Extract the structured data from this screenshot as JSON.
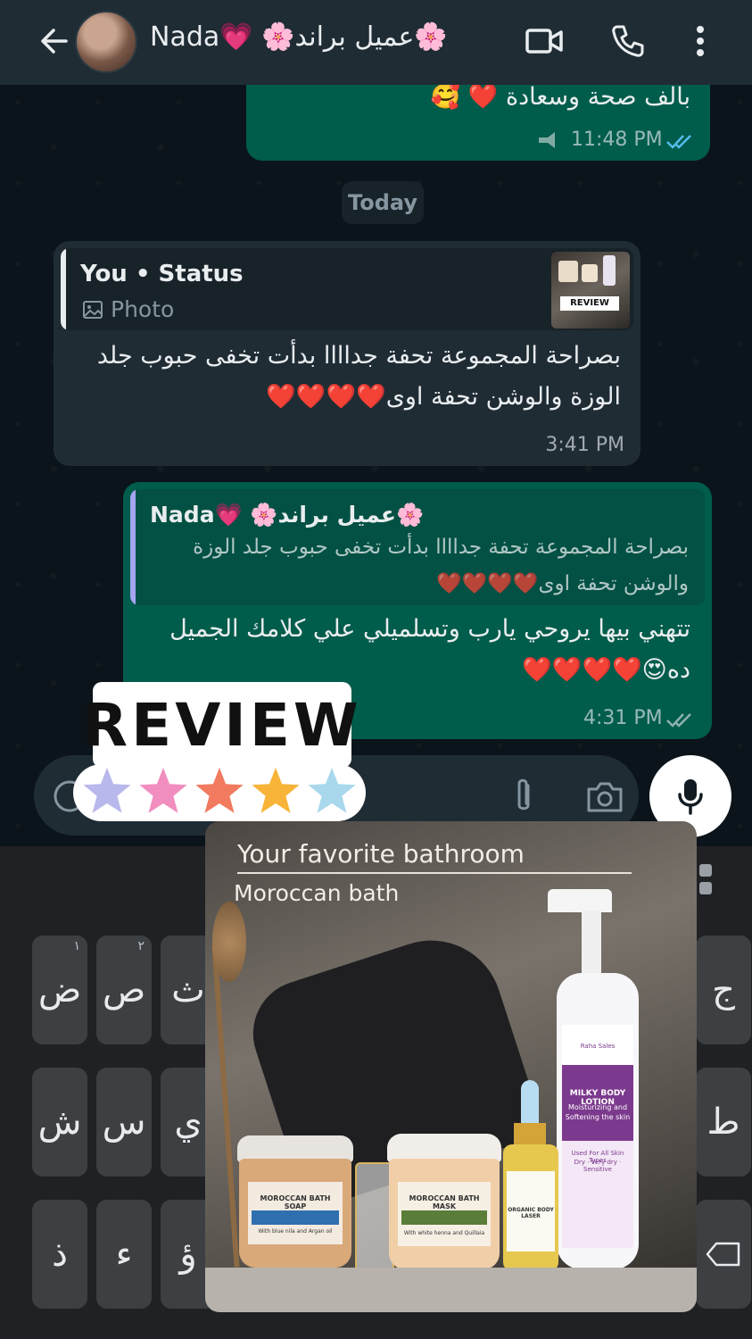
{
  "header": {
    "contact_name": "Nada💗 🌸عميل براند🌸"
  },
  "messages": {
    "prev_partial_text": "بالف صحة وسعادة ❤️ 🥰",
    "prev_time": "11:48 PM",
    "date_separator": "Today",
    "status_reply": {
      "sender": "You • Status",
      "media_label": "Photo",
      "text_line1": "بصراحة المجموعة تحفة جداااا بدأت تخفى حبوب جلد",
      "text_line2": "الوزة والوشن تحفة اوى❤️❤️❤️❤️",
      "time": "3:41 PM"
    },
    "reply": {
      "quoted_name": "Nada💗 🌸عميل براند🌸",
      "quoted_line1": "بصراحة المجموعة تحفة جداااا بدأت تخفى حبوب جلد الوزة",
      "quoted_line2": "والوشن تحفة اوى❤️❤️❤️❤️",
      "text_line1": "تتهني بيها يروحي يارب وتسلميلي علي كلامك الجميل",
      "text_line2": "ده😍❤️❤️❤️❤️",
      "time": "4:31 PM"
    }
  },
  "sticker": {
    "word": "REVIEW",
    "star_colors": [
      "#b9b8ec",
      "#f28dbf",
      "#f27a5e",
      "#f7b438",
      "#a9d8ec"
    ]
  },
  "product_card": {
    "title": "Your favorite bathroom",
    "subtitle": "Moroccan bath",
    "items": {
      "soap": "MOROCCAN BATH SOAP",
      "soap_sub": "With blue nila and Argan oil",
      "mask": "MOROCCAN BATH MASK",
      "mask_sub": "With white henna and Quillaia",
      "oil": "ORGANIC BODY LASER",
      "lotion": "MILKY BODY LOTION",
      "lotion_sub1": "Moisturizing and",
      "lotion_sub2": "Softening the skin",
      "lotion_types": "Used For All Skin Types",
      "lotion_types2": "Dry · Very dry · Sensitive",
      "brand": "Raha Sales"
    }
  },
  "keyboard": {
    "row1": [
      "ض",
      "ص",
      "ث"
    ],
    "row1_hints": [
      "١",
      "٢",
      ""
    ],
    "row2": [
      "ش",
      "س",
      "ي"
    ],
    "row3": [
      "ذ",
      "ء",
      "ؤ"
    ],
    "right_edge": [
      "ج",
      "ط"
    ]
  },
  "colors": {
    "header_bg": "#1f2c34",
    "outgoing_bubble": "#005c4b",
    "incoming_bubble": "#1f2c34",
    "read_ticks": "#53bdeb"
  }
}
